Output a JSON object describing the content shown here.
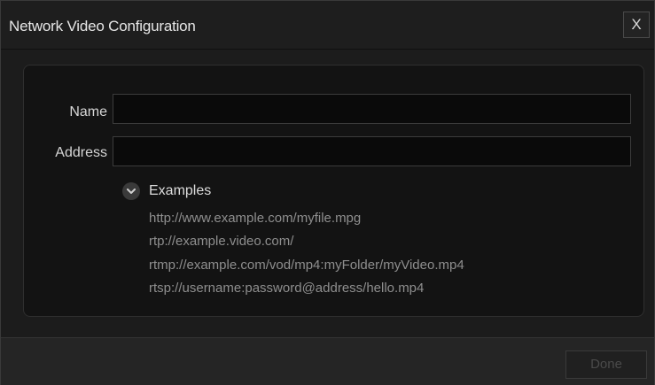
{
  "window": {
    "title": "Network Video Configuration",
    "close_label": "X"
  },
  "form": {
    "name_label": "Name",
    "name_value": "",
    "address_label": "Address",
    "address_value": ""
  },
  "examples": {
    "label": "Examples",
    "expanded": true,
    "items": [
      "http://www.example.com/myfile.mpg",
      "rtp://example.video.com/",
      "rtmp://example.com/vod/mp4:myFolder/myVideo.mp4",
      "rtsp://username:password@address/hello.mp4"
    ]
  },
  "footer": {
    "done_label": "Done",
    "done_enabled": false
  },
  "colors": {
    "background": "#1c1c1c",
    "panel": "#131313",
    "text": "#d6d6d6",
    "muted_text": "#8e8e8e",
    "disabled_text": "#4a4a4a"
  }
}
